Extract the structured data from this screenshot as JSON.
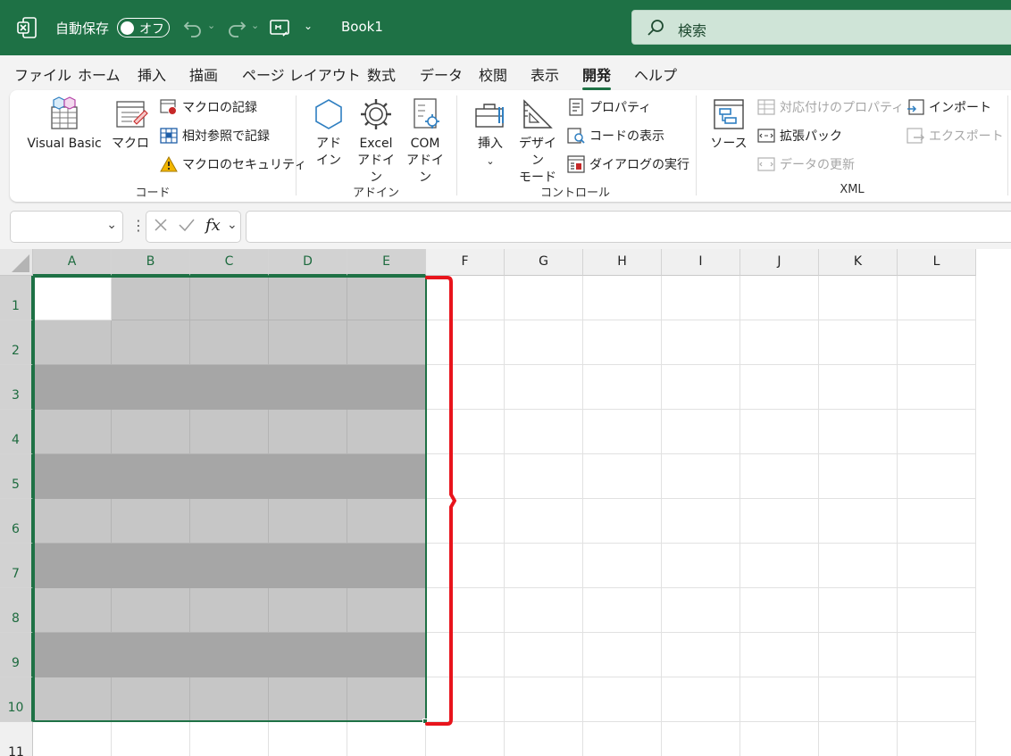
{
  "titlebar": {
    "autosave_label": "自動保存",
    "autosave_state": "オフ",
    "book_name": "Book1",
    "search_placeholder": "検索"
  },
  "menu": [
    "ファイル",
    "ホーム",
    "挿入",
    "描画",
    "ページ レイアウト",
    "数式",
    "データ",
    "校閲",
    "表示",
    "開発",
    "ヘルプ"
  ],
  "menu_active": "開発",
  "ribbon": {
    "code": {
      "label": "コード",
      "visual_basic": "Visual Basic",
      "macro": "マクロ",
      "record_macro": "マクロの記録",
      "relative_ref": "相対参照で記録",
      "macro_security": "マクロのセキュリティ"
    },
    "addins": {
      "label": "アドイン",
      "addin_l1": "アド",
      "addin_l2": "イン",
      "excel_addin_l1": "Excel",
      "excel_addin_l2": "アドイン",
      "com_addin_l1": "COM",
      "com_addin_l2": "アドイン"
    },
    "controls": {
      "label": "コントロール",
      "insert": "挿入",
      "design_l1": "デザイン",
      "design_l2": "モード",
      "properties": "プロパティ",
      "view_code": "コードの表示",
      "run_dialog": "ダイアログの実行"
    },
    "xml": {
      "label": "XML",
      "source": "ソース",
      "map_properties": "対応付けのプロパティ",
      "expansion_pack": "拡張パック",
      "refresh_data": "データの更新",
      "import": "インポート",
      "export": "エクスポート"
    }
  },
  "formula_bar": {
    "fx": "fx",
    "name_box": "",
    "formula": ""
  },
  "sheet": {
    "columns": [
      "A",
      "B",
      "C",
      "D",
      "E",
      "F",
      "G",
      "H",
      "I",
      "J",
      "K",
      "L"
    ],
    "rows": [
      "1",
      "2",
      "3",
      "4",
      "5",
      "6",
      "7",
      "8",
      "9",
      "10",
      "11"
    ],
    "selected_range": "A1:E10",
    "band_fill_rows": [
      3,
      5,
      7,
      9
    ]
  },
  "colors": {
    "brand": "#1e7145",
    "light_fill": "#c6c6c6",
    "dark_fill": "#a6a6a6",
    "bracket": "#e8141c"
  }
}
